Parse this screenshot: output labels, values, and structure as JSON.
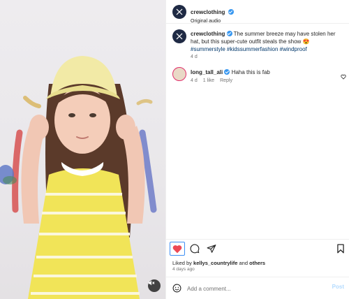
{
  "media": {
    "accent_colors": {
      "hat": "#f2eaa6",
      "dress_yellow": "#f1e458",
      "stripe": "#fbf7dc",
      "hair": "#5b3a2a",
      "collar": "#ffffff",
      "stroke_red": "#d85a5a",
      "stroke_blue": "#6f7bc8"
    }
  },
  "header": {
    "username": "crewclothing",
    "subtitle": "Original audio"
  },
  "caption": {
    "username": "crewclothing",
    "text_before": "The summer breeze may have stolen her hat, but this super-cute outfit steals the show 😍",
    "hashtags": [
      "#summerstyle",
      "#kidssummerfashion",
      "#windproof"
    ],
    "time": "4 d"
  },
  "comments": [
    {
      "username": "long_tall_ali",
      "text": "Haha this is fab",
      "time": "4 d",
      "likes": "1 like",
      "reply": "Reply"
    }
  ],
  "liked_by": {
    "prefix": "Liked by",
    "user": "kellys_countrylife",
    "and": "and",
    "others": "others"
  },
  "posted_ago": "4 days ago",
  "comment_box": {
    "placeholder": "Add a comment...",
    "post_label": "Post"
  },
  "colors": {
    "like_red": "#ed4956",
    "verified_blue": "#3897f0",
    "post_disabled": "#b3dbff"
  }
}
